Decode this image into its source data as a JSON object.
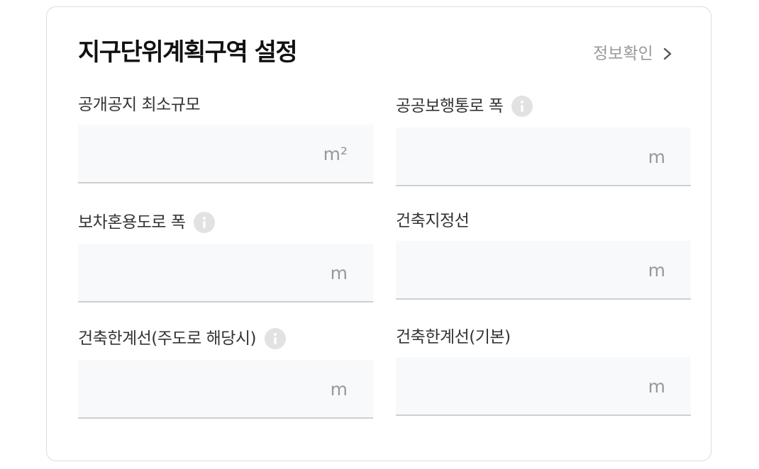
{
  "header": {
    "title": "지구단위계획구역 설정",
    "info_link": "정보확인"
  },
  "fields": [
    {
      "label": "공개공지 최소규모",
      "unit": "m²",
      "value": "",
      "has_info": false
    },
    {
      "label": "공공보행통로 폭",
      "unit": "m",
      "value": "",
      "has_info": true
    },
    {
      "label": "보차혼용도로 폭",
      "unit": "m",
      "value": "",
      "has_info": true
    },
    {
      "label": "건축지정선",
      "unit": "m",
      "value": "",
      "has_info": false
    },
    {
      "label": "건축한계선(주도로 해당시)",
      "unit": "m",
      "value": "",
      "has_info": true
    },
    {
      "label": "건축한계선(기본)",
      "unit": "m",
      "value": "",
      "has_info": false
    }
  ],
  "icons": {
    "info": "info-icon",
    "link": "chevron-right-icon"
  },
  "colors": {
    "input_bg": "#f8f9fa",
    "muted_text": "#999999",
    "info_icon_bg": "#e2e2e2"
  }
}
